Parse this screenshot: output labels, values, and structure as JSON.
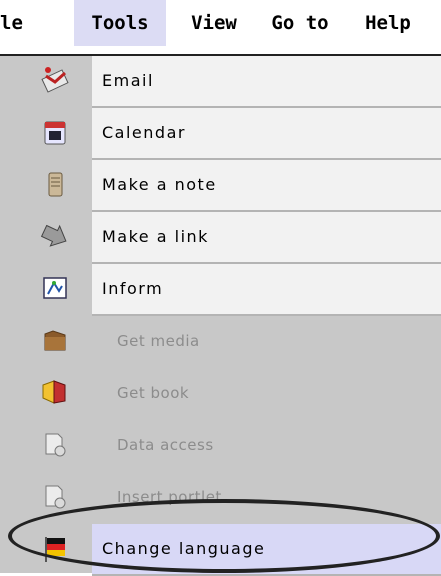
{
  "menubar": {
    "items": [
      {
        "id": "file",
        "label": "le"
      },
      {
        "id": "tools",
        "label": "Tools",
        "active": true
      },
      {
        "id": "view",
        "label": "View"
      },
      {
        "id": "goto",
        "label": "Go to"
      },
      {
        "id": "help",
        "label": "Help"
      }
    ]
  },
  "menu": {
    "items": [
      {
        "label": "Email",
        "icon": "email-icon",
        "enabled": true
      },
      {
        "label": "Calendar",
        "icon": "calendar-icon",
        "enabled": true
      },
      {
        "label": "Make a note",
        "icon": "note-icon",
        "enabled": true
      },
      {
        "label": "Make a link",
        "icon": "link-icon",
        "enabled": true
      },
      {
        "label": "Inform",
        "icon": "inform-icon",
        "enabled": true
      },
      {
        "label": "Get media",
        "icon": "media-folder-icon",
        "enabled": false
      },
      {
        "label": "Get book",
        "icon": "book-folder-icon",
        "enabled": false
      },
      {
        "label": "Data access",
        "icon": "data-access-icon",
        "enabled": false
      },
      {
        "label": "Insert portlet",
        "icon": "portlet-icon",
        "enabled": false
      },
      {
        "label": "Change language",
        "icon": "flag-icon",
        "enabled": true,
        "highlighted": true
      }
    ]
  },
  "colors": {
    "menubar_active": "#dcdcf4",
    "menu_bg": "#c8c8c8",
    "item_bg": "#f2f2f2",
    "highlight_bg": "#d8d8f6",
    "disabled_text": "#8c8c8c"
  }
}
